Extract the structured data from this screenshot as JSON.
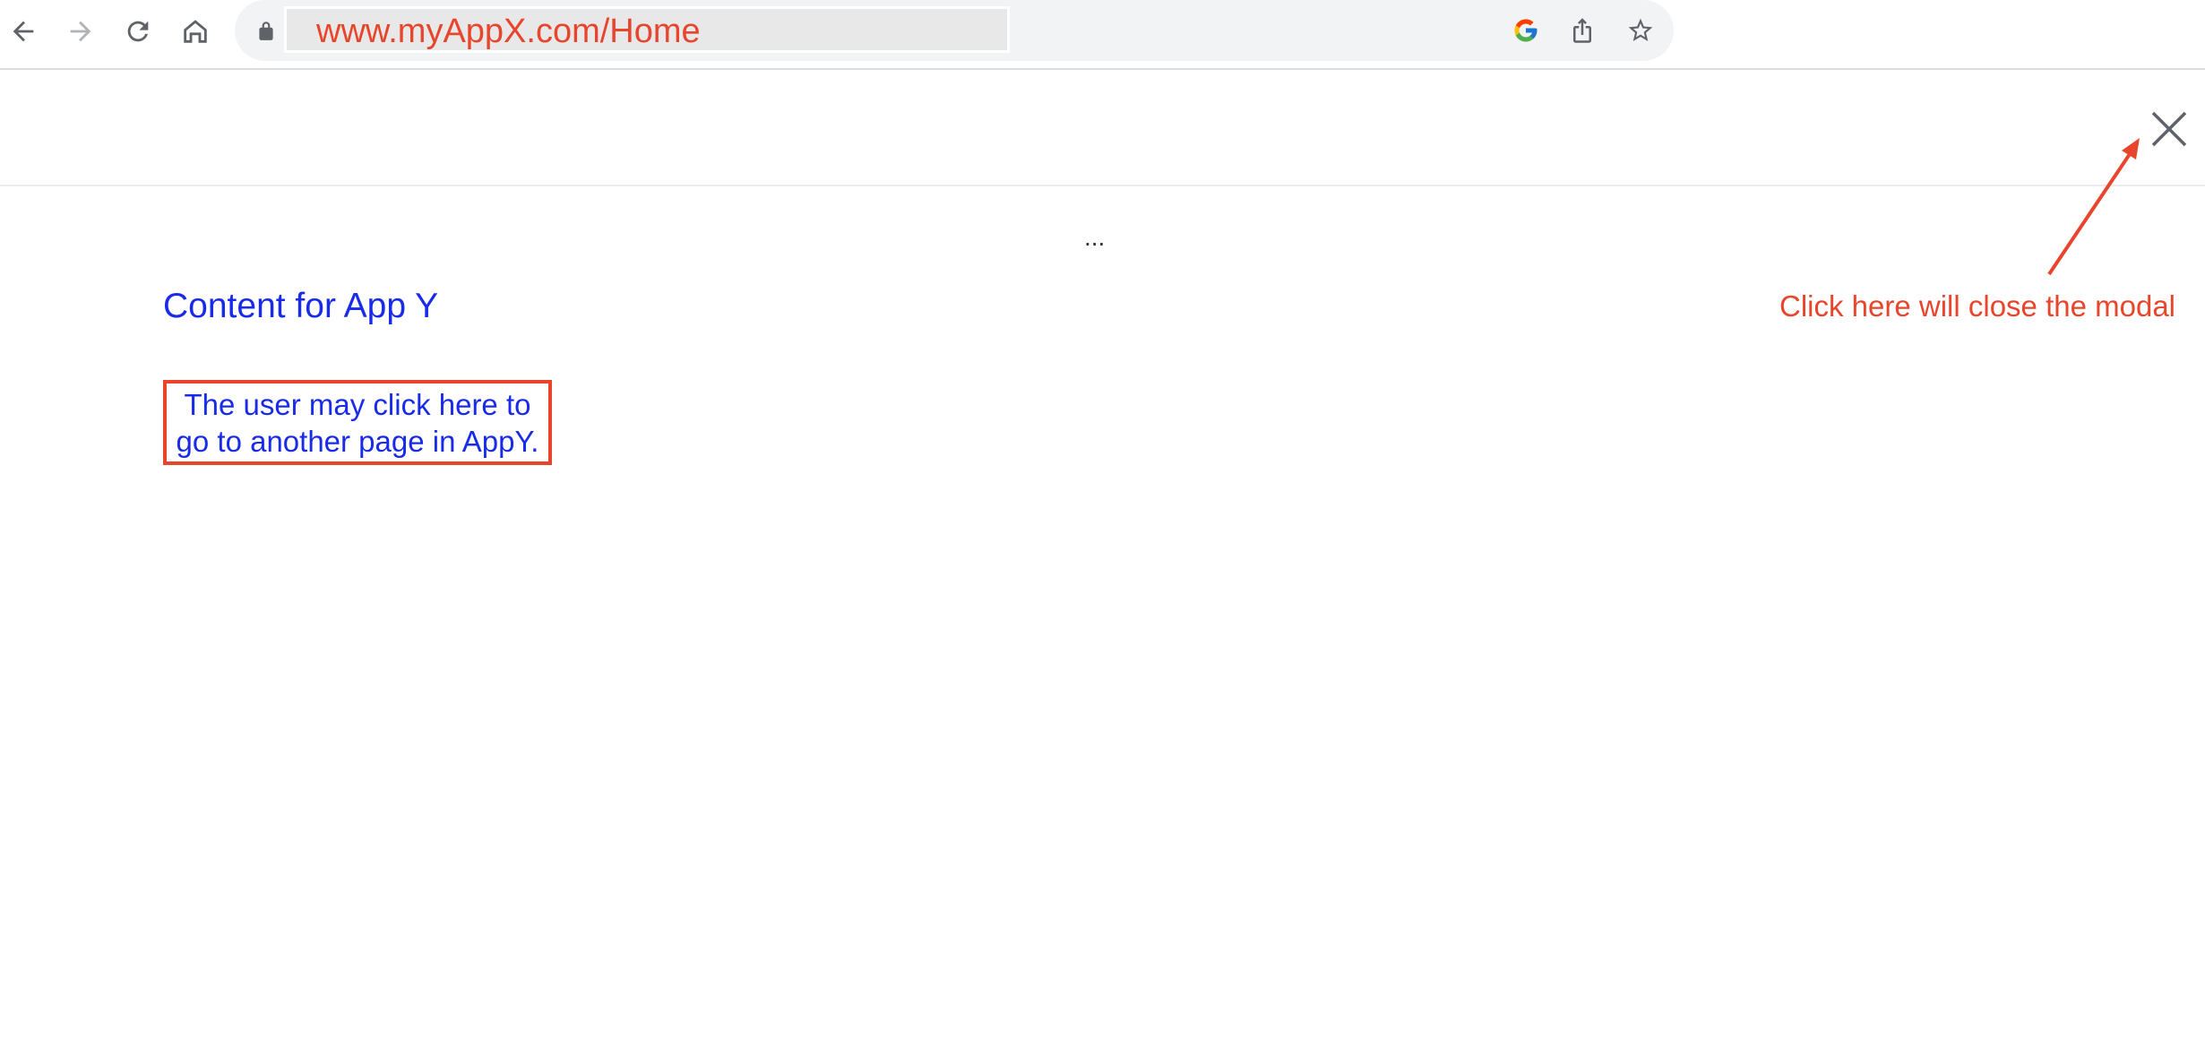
{
  "browser": {
    "url": "www.myAppX.com/Home",
    "icons": {
      "back": "back-arrow-icon",
      "forward": "forward-arrow-icon",
      "reload": "reload-icon",
      "home": "home-icon",
      "lock": "lock-icon",
      "google": "google-icon",
      "share": "share-icon",
      "bookmark": "star-icon"
    }
  },
  "modal": {
    "close_icon": "close-icon",
    "ellipsis": "...",
    "content_title": "Content for App Y",
    "link_text_line1": "The user may click here to",
    "link_text_line2": "go to another page in AppY."
  },
  "annotation": {
    "text": "Click here will close the modal"
  },
  "colors": {
    "annotation_red": "#e8452d",
    "link_blue": "#1a2be8"
  }
}
